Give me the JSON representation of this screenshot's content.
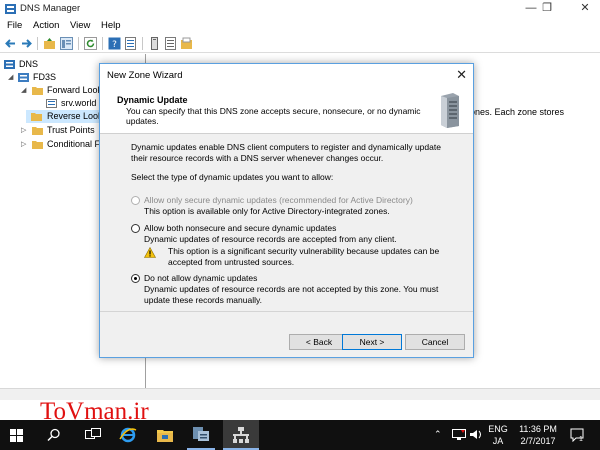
{
  "window": {
    "title": "DNS Manager",
    "controls": {
      "minimize": "—",
      "restore": "❐",
      "close": "✕"
    }
  },
  "menu": [
    "File",
    "Action",
    "View",
    "Help"
  ],
  "tree": {
    "root": "DNS",
    "server": "FD3S",
    "items": [
      "Forward Look",
      "srv.world",
      "Reverse Look",
      "Trust Points",
      "Conditional F"
    ]
  },
  "right_pane": {
    "text": "ones. Each zone stores"
  },
  "dialog": {
    "title": "New Zone Wizard",
    "close": "✕",
    "header_title": "Dynamic Update",
    "header_subtitle": "You can specify that this DNS zone accepts secure, nonsecure, or no dynamic updates.",
    "intro": "Dynamic updates enable DNS client computers to register and dynamically update their resource records with a DNS server whenever changes occur.",
    "prompt": "Select the type of dynamic updates you want to allow:",
    "options": [
      {
        "label": "Allow only secure dynamic updates (recommended for Active Directory)",
        "desc": "This option is available only for Active Directory-integrated zones.",
        "selected": false,
        "disabled": true
      },
      {
        "label": "Allow both nonsecure and secure dynamic updates",
        "desc": "Dynamic updates of resource records are accepted from any client.",
        "warning": "This option is a significant security vulnerability because updates can be accepted from untrusted sources.",
        "selected": false,
        "disabled": false
      },
      {
        "label": "Do not allow dynamic updates",
        "desc": "Dynamic updates of resource records are not accepted by this zone. You must update these records manually.",
        "selected": true,
        "disabled": false
      }
    ],
    "buttons": {
      "back": "< Back",
      "next": "Next >",
      "cancel": "Cancel"
    }
  },
  "taskbar": {
    "watermark": "ToVman.ir",
    "language": "ENG",
    "locale": "JA",
    "time": "11:36 PM",
    "date": "2/7/2017",
    "notification_count": "1"
  },
  "colors": {
    "accent": "#0078d7",
    "selection": "#cce8ff",
    "taskbar": "#101010",
    "watermark": "#e01010"
  }
}
